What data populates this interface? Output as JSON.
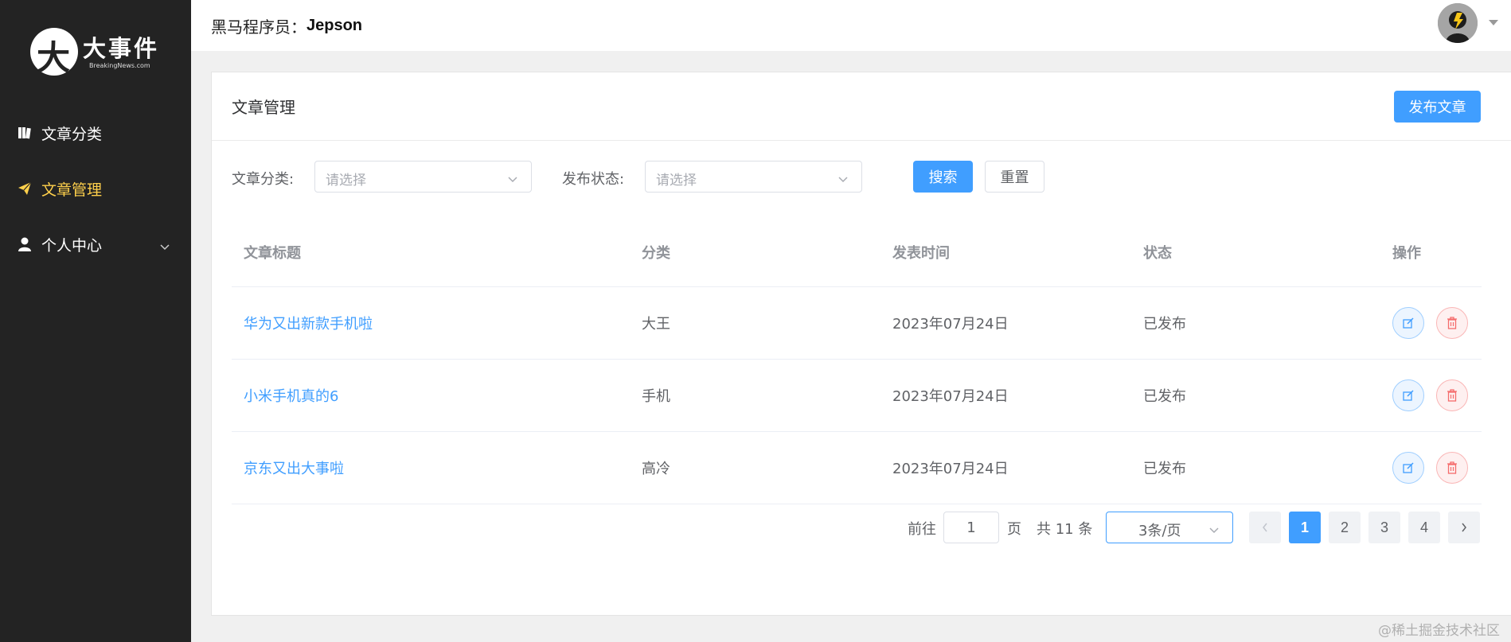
{
  "sidebar": {
    "logo": {
      "title": "大事件",
      "subtitle": "BreakingNews.com"
    },
    "items": [
      {
        "label": "文章分类",
        "icon": "book-icon",
        "active": false
      },
      {
        "label": "文章管理",
        "icon": "paper-plane-icon",
        "active": true
      },
      {
        "label": "个人中心",
        "icon": "user-icon",
        "active": false,
        "expandable": true
      }
    ]
  },
  "header": {
    "label": "黑马程序员：",
    "username": "Jepson"
  },
  "card": {
    "title": "文章管理",
    "publish_label": "发布文章",
    "filter": {
      "category_label": "文章分类:",
      "category_placeholder": "请选择",
      "status_label": "发布状态:",
      "status_placeholder": "请选择",
      "search_label": "搜索",
      "reset_label": "重置"
    },
    "table": {
      "columns": [
        "文章标题",
        "分类",
        "发表时间",
        "状态",
        "操作"
      ],
      "rows": [
        {
          "title": "华为又出新款手机啦",
          "category": "大王",
          "date": "2023年07月24日",
          "status": "已发布"
        },
        {
          "title": "小米手机真的6",
          "category": "手机",
          "date": "2023年07月24日",
          "status": "已发布"
        },
        {
          "title": "京东又出大事啦",
          "category": "高冷",
          "date": "2023年07月24日",
          "status": "已发布"
        }
      ]
    }
  },
  "pagination": {
    "goto_label": "前往",
    "goto_value": "1",
    "page_unit": "页",
    "total_text": "共 11 条",
    "page_size": "3条/页",
    "pages": [
      "1",
      "2",
      "3",
      "4"
    ],
    "current_page": "1"
  },
  "watermark": "@稀土掘金技术社区",
  "colors": {
    "sidebar_bg": "#232323",
    "active_menu": "#ffd04b",
    "primary": "#409eff",
    "danger": "#f56c6c"
  }
}
